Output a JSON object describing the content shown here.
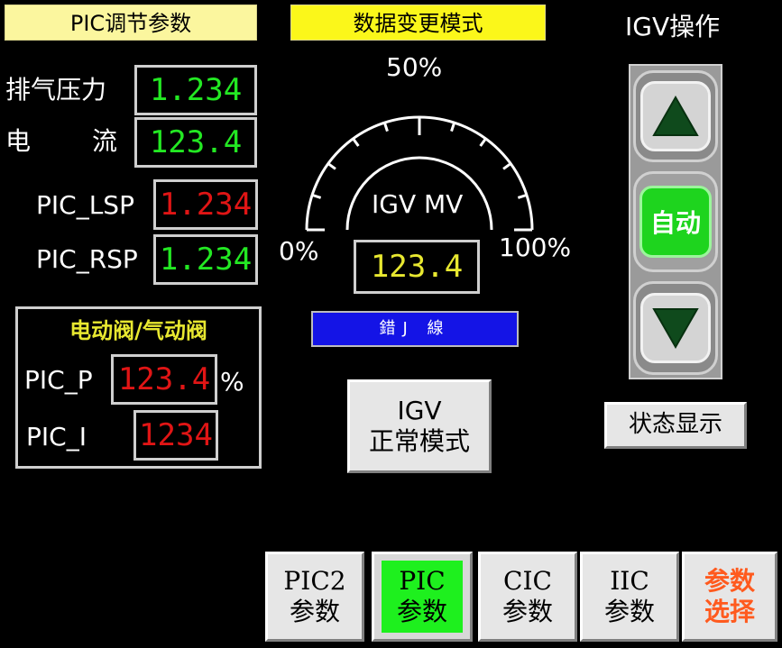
{
  "headers": {
    "pic_params": "PIC调节参数",
    "data_change_mode": "数据变更模式",
    "igv_op": "IGV操作"
  },
  "left": {
    "exhaust_pressure": {
      "label": "排气压力",
      "value": "1.234"
    },
    "current": {
      "label_a": "电",
      "label_b": "流",
      "value": "123.4"
    },
    "pic_lsp": {
      "label": "PIC_LSP",
      "value": "1.234"
    },
    "pic_rsp": {
      "label": "PIC_RSP",
      "value": "1.234"
    }
  },
  "valve_panel": {
    "title": "电动阀/气动阀",
    "pic_p": {
      "label": "PIC_P",
      "value": "123.4",
      "unit": "%"
    },
    "pic_i": {
      "label": "PIC_I",
      "value": "1234"
    }
  },
  "gauge": {
    "label_mid": "50%",
    "label_min": "0%",
    "label_max": "100%",
    "title": "IGV MV",
    "value": "123.4",
    "status": "錯J 線"
  },
  "igv_mode_button": {
    "line1": "IGV",
    "line2": "正常模式"
  },
  "igv_controls": {
    "auto_label": "自动"
  },
  "status_button": "状态显示",
  "tabs": [
    {
      "line1": "PIC2",
      "line2": "参数",
      "active": false
    },
    {
      "line1": "PIC",
      "line2": "参数",
      "active": true
    },
    {
      "line1": "CIC",
      "line2": "参数",
      "active": false
    },
    {
      "line1": "IIC",
      "line2": "参数",
      "active": false
    },
    {
      "line1": "参数",
      "line2": "选择",
      "active": false
    }
  ],
  "colors": {
    "green_value": "#23e823",
    "red_value": "#e01515",
    "yellow_value": "#e8e830",
    "status_bar": "#1414e6",
    "auto_button": "#1ed41e",
    "active_tab": "#1ef01e",
    "select_tab_text": "#ff5a1e",
    "triangle": "#0f4a1c"
  }
}
